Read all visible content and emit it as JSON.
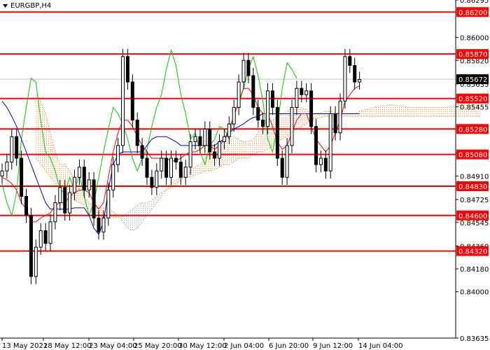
{
  "symbol_label": "EURGBP,H4",
  "colors": {
    "background": "#ffffff",
    "candle": "#000000",
    "level_line": "#ff0000",
    "level_label_bg": "#ff0000",
    "level_label_text": "#ffffff",
    "current_label_bg": "#000000",
    "current_label_text": "#ffffff",
    "tenkan": "#ff0000",
    "kijun": "#0000cd",
    "chikou": "#00cc00",
    "cloud_bear": "#f4a460",
    "cloud_bull": "#b0b0e0",
    "axis_line": "#000000"
  },
  "chart_data": {
    "type": "candlestick",
    "symbol": "EURGBP",
    "timeframe": "H4",
    "ylim": [
      0.83635,
      0.86295
    ],
    "y_ticks": [
      "0.86295",
      "0.86000",
      "0.85820",
      "0.85635",
      "0.85455",
      "0.85090",
      "0.84910",
      "0.84725",
      "0.84545",
      "0.84360",
      "0.84180",
      "0.84000",
      "0.83635"
    ],
    "x_ticks": [
      "13 May 2022",
      "18 May 12:00",
      "23 May 04:00",
      "25 May 20:00",
      "30 May 12:00",
      "2 Jun 04:00",
      "6 Jun 20:00",
      "9 Jun 12:00",
      "14 Jun 04:00"
    ],
    "levels": [
      0.862,
      0.8587,
      0.8552,
      0.8528,
      0.8508,
      0.8483,
      0.846,
      0.8432
    ],
    "level_labels": [
      "0.86200",
      "0.85870",
      "0.85520",
      "0.85280",
      "0.85080",
      "0.84830",
      "0.84600",
      "0.84320"
    ],
    "current_price": 0.85672,
    "current_label": "0.85672",
    "candles_close": [
      0.8495,
      0.8502,
      0.8522,
      0.8505,
      0.8475,
      0.846,
      0.8412,
      0.8435,
      0.8448,
      0.8438,
      0.8455,
      0.847,
      0.8482,
      0.8462,
      0.8478,
      0.849,
      0.8498,
      0.848,
      0.8488,
      0.8458,
      0.8447,
      0.8458,
      0.848,
      0.85,
      0.8515,
      0.8585,
      0.8565,
      0.8535,
      0.8515,
      0.8505,
      0.849,
      0.8482,
      0.8495,
      0.8505,
      0.849,
      0.8505,
      0.8502,
      0.849,
      0.8498,
      0.8518,
      0.8522,
      0.8515,
      0.8528,
      0.851,
      0.8505,
      0.8518,
      0.8522,
      0.8532,
      0.8545,
      0.8565,
      0.8582,
      0.857,
      0.8545,
      0.8535,
      0.853,
      0.8558,
      0.8545,
      0.8505,
      0.849,
      0.8515,
      0.8545,
      0.856,
      0.8555,
      0.8558,
      0.853,
      0.85,
      0.8505,
      0.8495,
      0.854,
      0.8525,
      0.855,
      0.8585,
      0.8578,
      0.8565,
      0.8567
    ],
    "tenkan_sen": [
      0.849,
      0.8488,
      0.8485,
      0.848,
      0.847,
      0.8465,
      0.8455,
      0.8455,
      0.8458,
      0.846,
      0.8462,
      0.8468,
      0.847,
      0.847,
      0.8475,
      0.8478,
      0.848,
      0.848,
      0.8478,
      0.847,
      0.8465,
      0.847,
      0.849,
      0.851,
      0.8525,
      0.8535,
      0.8535,
      0.853,
      0.8522,
      0.8515,
      0.851,
      0.8505,
      0.8505,
      0.8505,
      0.8505,
      0.8503,
      0.8503,
      0.8505,
      0.8508,
      0.851,
      0.851,
      0.8512,
      0.8515,
      0.8515,
      0.8512,
      0.8515,
      0.852,
      0.8528,
      0.8538,
      0.855,
      0.856,
      0.856,
      0.8555,
      0.8545,
      0.854,
      0.854,
      0.853,
      0.8518,
      0.8512,
      0.8515,
      0.8525,
      0.8535,
      0.854,
      0.854,
      0.853,
      0.852,
      0.8515,
      0.851,
      0.8515,
      0.8525,
      0.8535,
      0.855,
      0.8555,
      0.856,
      0.8562
    ],
    "kijun_sen": [
      0.855,
      0.8545,
      0.8538,
      0.853,
      0.852,
      0.851,
      0.85,
      0.849,
      0.848,
      0.847,
      0.8465,
      0.8465,
      0.8465,
      0.8465,
      0.8465,
      0.8466,
      0.8466,
      0.8466,
      0.846,
      0.845,
      0.8445,
      0.8455,
      0.848,
      0.85,
      0.8508,
      0.851,
      0.851,
      0.851,
      0.851,
      0.851,
      0.8515,
      0.852,
      0.8522,
      0.8522,
      0.8522,
      0.852,
      0.8518,
      0.8515,
      0.8515,
      0.8515,
      0.8515,
      0.8515,
      0.8515,
      0.8515,
      0.8515,
      0.8518,
      0.852,
      0.8525,
      0.8528,
      0.853,
      0.8532,
      0.8535,
      0.8537,
      0.8538,
      0.854,
      0.854,
      0.854,
      0.854,
      0.854,
      0.854,
      0.854,
      0.854,
      0.854,
      0.854,
      0.854,
      0.854,
      0.854,
      0.854,
      0.854,
      0.854,
      0.854,
      0.854,
      0.854,
      0.854,
      0.854
    ],
    "chikou_span": [
      0.8485,
      0.847,
      0.846,
      0.8478,
      0.852,
      0.8545,
      0.8568,
      0.8565,
      0.8535,
      0.851,
      0.8505,
      0.8495,
      0.848,
      0.8478,
      0.849,
      0.848,
      0.8492,
      0.8475,
      0.846,
      0.847,
      0.849,
      0.851,
      0.8528,
      0.8545,
      0.854,
      0.8532,
      0.852,
      0.8505,
      0.8495,
      0.8505,
      0.8512,
      0.853,
      0.8545,
      0.8555,
      0.8575,
      0.859,
      0.8578,
      0.8555,
      0.854,
      0.852,
      0.8525,
      0.851,
      0.85,
      0.8515,
      0.852,
      0.853,
      0.8528,
      0.852,
      0.854,
      0.8548,
      0.856,
      0.8575,
      0.8585,
      0.857,
      0.855,
      0.852,
      0.851,
      0.853,
      0.856,
      0.858,
      0.8575,
      0.8568
    ],
    "cloud_span_a": [
      0.8555,
      0.855,
      0.854,
      0.8525,
      0.851,
      0.85,
      0.85,
      0.8495,
      0.8488,
      0.848,
      0.8475,
      0.847,
      0.8468,
      0.8466,
      0.8466,
      0.8465,
      0.8463,
      0.846,
      0.8455,
      0.845,
      0.8448,
      0.845,
      0.8455,
      0.846,
      0.8465,
      0.847,
      0.8475,
      0.848,
      0.8485,
      0.8488,
      0.849,
      0.8492,
      0.8495,
      0.8498,
      0.85,
      0.8505,
      0.851,
      0.8515,
      0.8518,
      0.852,
      0.8522,
      0.8522,
      0.852,
      0.8518,
      0.8518,
      0.852,
      0.8525,
      0.8528,
      0.8532,
      0.8535,
      0.8538,
      0.854,
      0.8542,
      0.8545,
      0.8545,
      0.8545,
      0.8543,
      0.854,
      0.854,
      0.8541,
      0.8542,
      0.8542,
      0.8541,
      0.854,
      0.854,
      0.854,
      0.854,
      0.8542,
      0.8543,
      0.8544,
      0.8545,
      0.8546,
      0.8546,
      0.8547,
      0.8547,
      0.8546,
      0.8546,
      0.8545,
      0.8545,
      0.8545,
      0.8545,
      0.8545,
      0.8545,
      0.8545,
      0.8545,
      0.8545,
      0.8546,
      0.8547,
      0.8547,
      0.8548,
      0.8548,
      0.855,
      0.855
    ],
    "cloud_span_b": [
      0.8505,
      0.85,
      0.8495,
      0.849,
      0.8485,
      0.848,
      0.8478,
      0.8475,
      0.8472,
      0.847,
      0.8468,
      0.8465,
      0.8462,
      0.846,
      0.8458,
      0.8458,
      0.8458,
      0.8458,
      0.846,
      0.8462,
      0.8465,
      0.8468,
      0.847,
      0.847,
      0.8472,
      0.8475,
      0.8478,
      0.848,
      0.8482,
      0.8485,
      0.8488,
      0.849,
      0.849,
      0.8492,
      0.8493,
      0.8495,
      0.8495,
      0.8496,
      0.8498,
      0.85,
      0.85,
      0.8502,
      0.8505,
      0.8505,
      0.8505,
      0.8508,
      0.851,
      0.851,
      0.8512,
      0.8515,
      0.8518,
      0.852,
      0.8522,
      0.8525,
      0.8528,
      0.853,
      0.8532,
      0.8535,
      0.8536,
      0.8537,
      0.8538,
      0.8538,
      0.8538,
      0.8538,
      0.8538,
      0.8538,
      0.8538,
      0.8538,
      0.8538,
      0.8538,
      0.8538,
      0.8538,
      0.8538,
      0.8538,
      0.8538,
      0.8538,
      0.8538,
      0.8538,
      0.8538,
      0.8538,
      0.8538,
      0.8538,
      0.8538,
      0.8538,
      0.8538,
      0.8538,
      0.8538,
      0.8538,
      0.8538,
      0.8538,
      0.8538,
      0.8538,
      0.8538
    ],
    "grid": false
  }
}
